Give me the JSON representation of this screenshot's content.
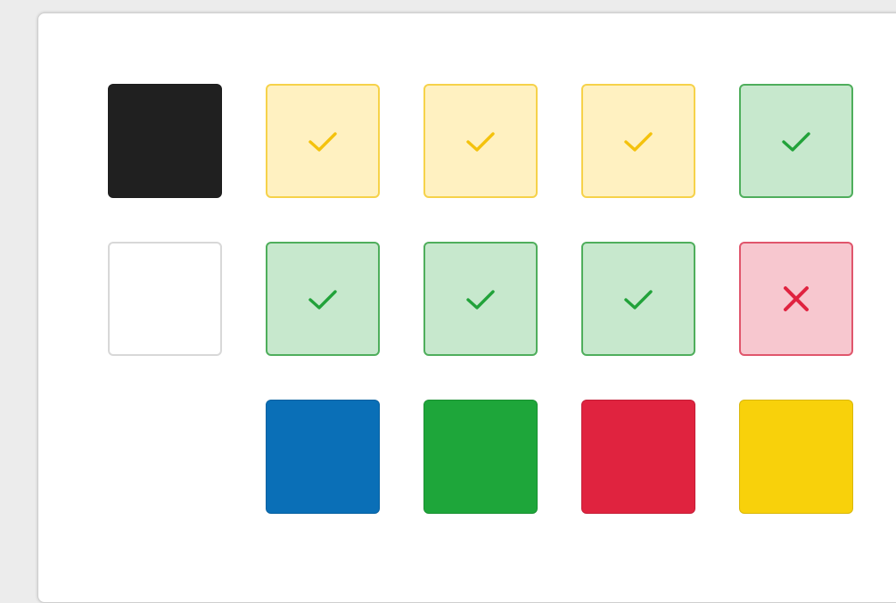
{
  "palette": {
    "black": "#202020",
    "white": "#ffffff",
    "white_border": "#d8d8d8",
    "pending_bg": "#fff1c1",
    "pending_border": "#f6d24a",
    "pending_mark": "#f4c20d",
    "correct_bg": "#c7e8cd",
    "correct_border": "#4fae5c",
    "correct_mark": "#22a23a",
    "wrong_bg": "#f7c7cf",
    "wrong_border": "#e0566c",
    "wrong_mark": "#e02340",
    "blue": "#0a6fb7",
    "green": "#1ea63a",
    "red": "#e0233f",
    "yellow": "#f8d10b"
  },
  "rows": [
    [
      {
        "kind": "swatch",
        "color": "black"
      },
      {
        "kind": "state",
        "state": "pending",
        "icon": "check-icon"
      },
      {
        "kind": "state",
        "state": "pending",
        "icon": "check-icon"
      },
      {
        "kind": "state",
        "state": "pending",
        "icon": "check-icon"
      },
      {
        "kind": "state",
        "state": "correct",
        "icon": "check-icon"
      }
    ],
    [
      {
        "kind": "swatch",
        "color": "white"
      },
      {
        "kind": "state",
        "state": "correct",
        "icon": "check-icon"
      },
      {
        "kind": "state",
        "state": "correct",
        "icon": "check-icon"
      },
      {
        "kind": "state",
        "state": "correct",
        "icon": "check-icon"
      },
      {
        "kind": "state",
        "state": "wrong",
        "icon": "x-icon"
      }
    ],
    [
      {
        "kind": "empty"
      },
      {
        "kind": "swatch",
        "color": "blue"
      },
      {
        "kind": "swatch",
        "color": "green"
      },
      {
        "kind": "swatch",
        "color": "red"
      },
      {
        "kind": "swatch",
        "color": "yellow"
      }
    ]
  ]
}
